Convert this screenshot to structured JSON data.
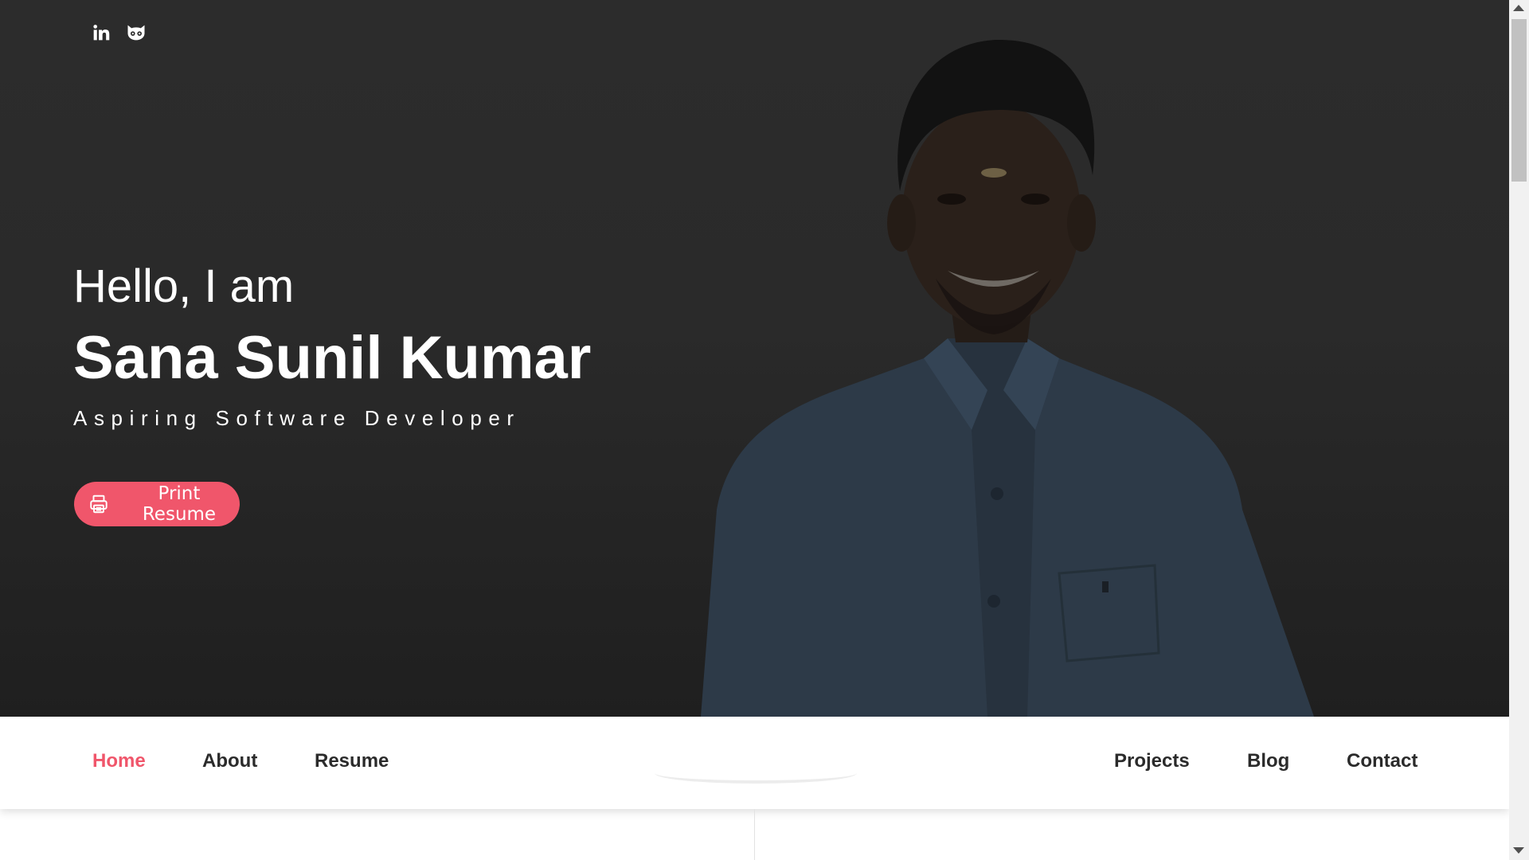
{
  "social": {
    "linkedin_icon": "linkedin-icon",
    "github_icon": "github-icon"
  },
  "hero": {
    "greeting": "Hello, I am",
    "name": "Sana Sunil Kumar",
    "role": "Aspiring Software Developer",
    "print_button": "Print Resume",
    "print_icon": "printer-icon"
  },
  "nav": {
    "home": "Home",
    "about": "About",
    "resume": "Resume",
    "projects": "Projects",
    "blog": "Blog",
    "contact": "Contact"
  },
  "colors": {
    "accent": "#f0566b",
    "hero_bg": "#2a2a2a",
    "nav_text": "#2b2b2b"
  }
}
